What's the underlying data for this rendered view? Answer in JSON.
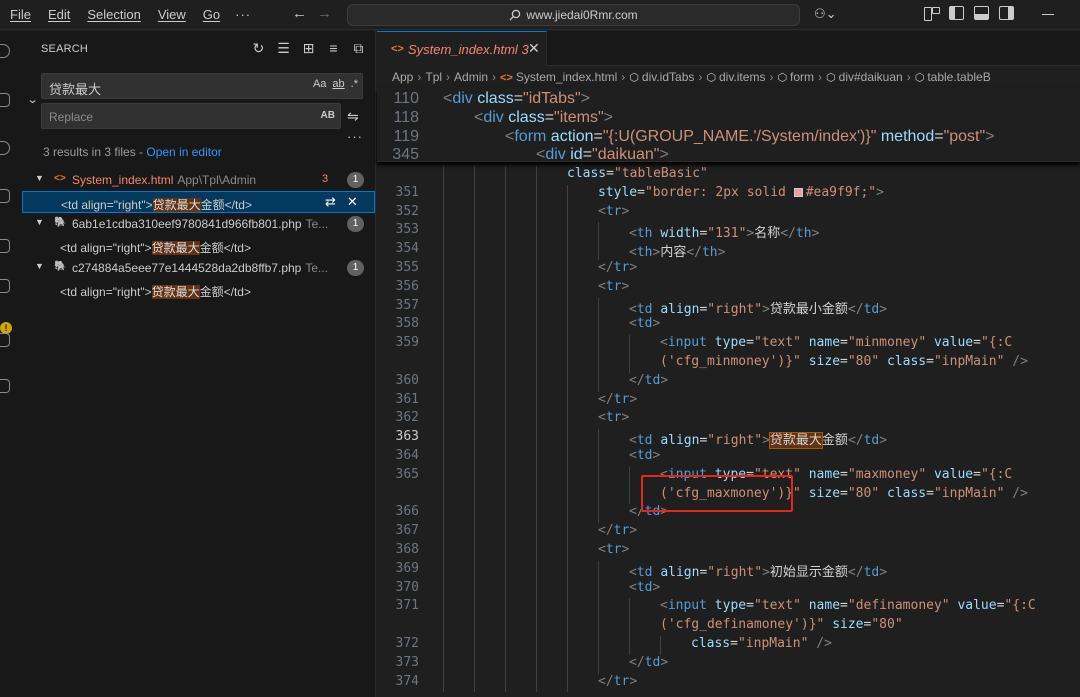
{
  "titlebar": {
    "menu": [
      "File",
      "Edit",
      "Selection",
      "View",
      "Go"
    ],
    "more": "···",
    "command_center": "www.jiedai0Rmr.com"
  },
  "sidebar": {
    "title": "SEARCH",
    "search_value": "贷款最大",
    "search_opts": [
      "Aa",
      "ab",
      ".*"
    ],
    "replace_placeholder": "Replace",
    "replace_opt": "AB",
    "summary": "3 results in 3 files - ",
    "open_in_editor": "Open in editor",
    "files": [
      {
        "name": "System_index.html",
        "path": "App\\Tpl\\Admin",
        "problems": "3",
        "count": "1",
        "match": {
          "pre": "<td align=\"right\">",
          "hit": "贷款最大",
          "post": "金额</td>"
        }
      },
      {
        "name": "6ab1e1cdba310eef9780841d966fb801.php",
        "path": "Te...",
        "count": "1",
        "match": {
          "pre": "<td align=\"right\">",
          "hit": "贷款最大",
          "post": "金额</td>"
        }
      },
      {
        "name": "c274884a5eee77e1444528da2db8ffb7.php",
        "path": "Te...",
        "count": "1",
        "match": {
          "pre": "<td align=\"right\">",
          "hit": "贷款最大",
          "post": "金额</td>"
        }
      }
    ]
  },
  "editor": {
    "tab": {
      "name": "System_index.html",
      "problems": "3"
    },
    "breadcrumbs": [
      "App",
      "Tpl",
      "Admin",
      "System_index.html",
      "div.idTabs",
      "div.items",
      "form",
      "div#daikuan",
      "table.tableB"
    ],
    "sticky": [
      {
        "ln": "110",
        "indent": 0,
        "parts": [
          [
            "t",
            "<"
          ],
          [
            "tg",
            "div"
          ],
          [
            "tx",
            " "
          ],
          [
            "at",
            "class"
          ],
          [
            "tx",
            "="
          ],
          [
            "st",
            "\"idTabs\""
          ],
          [
            "t",
            ">"
          ]
        ]
      },
      {
        "ln": "118",
        "indent": 1,
        "parts": [
          [
            "t",
            "<"
          ],
          [
            "tg",
            "div"
          ],
          [
            "tx",
            " "
          ],
          [
            "at",
            "class"
          ],
          [
            "tx",
            "="
          ],
          [
            "st",
            "\"items\""
          ],
          [
            "t",
            ">"
          ]
        ]
      },
      {
        "ln": "119",
        "indent": 2,
        "parts": [
          [
            "t",
            "<"
          ],
          [
            "tg",
            "form"
          ],
          [
            "tx",
            " "
          ],
          [
            "at",
            "action"
          ],
          [
            "tx",
            "="
          ],
          [
            "st",
            "\"{:U(GROUP_NAME.'/System/index')}\""
          ],
          [
            "tx",
            " "
          ],
          [
            "at",
            "method"
          ],
          [
            "tx",
            "="
          ],
          [
            "st",
            "\"post\""
          ],
          [
            "t",
            ">"
          ]
        ]
      },
      {
        "ln": "345",
        "indent": 3,
        "parts": [
          [
            "t",
            "<"
          ],
          [
            "tg",
            "div"
          ],
          [
            "tx",
            " "
          ],
          [
            "at",
            "id"
          ],
          [
            "tx",
            "="
          ],
          [
            "st",
            "\"daikuan\""
          ],
          [
            "t",
            ">"
          ]
        ]
      }
    ],
    "lines": [
      {
        "ln": "",
        "indent": 4,
        "parts": [
          [
            "at",
            "class"
          ],
          [
            "tx",
            "="
          ],
          [
            "st",
            "\"tableBasic\""
          ]
        ]
      },
      {
        "ln": "351",
        "indent": 5,
        "parts": [
          [
            "at",
            "style"
          ],
          [
            "tx",
            "="
          ],
          [
            "st",
            "\"border: 2px solid "
          ],
          [
            "sw",
            ""
          ],
          [
            "st",
            "#ea9f9f;\""
          ],
          [
            "t",
            ">"
          ]
        ]
      },
      {
        "ln": "352",
        "indent": 5,
        "parts": [
          [
            "t",
            "<"
          ],
          [
            "tg",
            "tr"
          ],
          [
            "t",
            ">"
          ]
        ]
      },
      {
        "ln": "353",
        "indent": 6,
        "parts": [
          [
            "t",
            "<"
          ],
          [
            "tg",
            "th"
          ],
          [
            "tx",
            " "
          ],
          [
            "at",
            "width"
          ],
          [
            "tx",
            "="
          ],
          [
            "st",
            "\"131\""
          ],
          [
            "t",
            ">"
          ],
          [
            "tx",
            "名称"
          ],
          [
            "t",
            "</"
          ],
          [
            "tg",
            "th"
          ],
          [
            "t",
            ">"
          ]
        ]
      },
      {
        "ln": "354",
        "indent": 6,
        "parts": [
          [
            "t",
            "<"
          ],
          [
            "tg",
            "th"
          ],
          [
            "t",
            ">"
          ],
          [
            "tx",
            "内容"
          ],
          [
            "t",
            "</"
          ],
          [
            "tg",
            "th"
          ],
          [
            "t",
            ">"
          ]
        ]
      },
      {
        "ln": "355",
        "indent": 5,
        "parts": [
          [
            "t",
            "</"
          ],
          [
            "tg",
            "tr"
          ],
          [
            "t",
            ">"
          ]
        ]
      },
      {
        "ln": "356",
        "indent": 5,
        "parts": [
          [
            "t",
            "<"
          ],
          [
            "tg",
            "tr"
          ],
          [
            "t",
            ">"
          ]
        ]
      },
      {
        "ln": "357",
        "indent": 6,
        "parts": [
          [
            "t",
            "<"
          ],
          [
            "tg",
            "td"
          ],
          [
            "tx",
            " "
          ],
          [
            "at",
            "align"
          ],
          [
            "tx",
            "="
          ],
          [
            "st",
            "\"right\""
          ],
          [
            "t",
            ">"
          ],
          [
            "tx",
            "贷款最小金额"
          ],
          [
            "t",
            "</"
          ],
          [
            "tg",
            "td"
          ],
          [
            "t",
            ">"
          ]
        ]
      },
      {
        "ln": "358",
        "indent": 6,
        "parts": [
          [
            "t",
            "<"
          ],
          [
            "tg",
            "td"
          ],
          [
            "t",
            ">"
          ]
        ]
      },
      {
        "ln": "359",
        "indent": 7,
        "parts": [
          [
            "t",
            "<"
          ],
          [
            "tg",
            "input"
          ],
          [
            "tx",
            " "
          ],
          [
            "at",
            "type"
          ],
          [
            "tx",
            "="
          ],
          [
            "st",
            "\"text\""
          ],
          [
            "tx",
            " "
          ],
          [
            "at",
            "name"
          ],
          [
            "tx",
            "="
          ],
          [
            "st",
            "\"minmoney\""
          ],
          [
            "tx",
            " "
          ],
          [
            "at",
            "value"
          ],
          [
            "tx",
            "="
          ],
          [
            "st",
            "\"{:C"
          ]
        ]
      },
      {
        "ln": "",
        "indent": 7,
        "parts": [
          [
            "st",
            "('cfg_minmoney')}\""
          ],
          [
            "tx",
            " "
          ],
          [
            "at",
            "size"
          ],
          [
            "tx",
            "="
          ],
          [
            "st",
            "\"80\""
          ],
          [
            "tx",
            " "
          ],
          [
            "at",
            "class"
          ],
          [
            "tx",
            "="
          ],
          [
            "st",
            "\"inpMain\""
          ],
          [
            "tx",
            " "
          ],
          [
            "t",
            "/>"
          ]
        ]
      },
      {
        "ln": "360",
        "indent": 6,
        "parts": [
          [
            "t",
            "</"
          ],
          [
            "tg",
            "td"
          ],
          [
            "t",
            ">"
          ]
        ]
      },
      {
        "ln": "361",
        "indent": 5,
        "parts": [
          [
            "t",
            "</"
          ],
          [
            "tg",
            "tr"
          ],
          [
            "t",
            ">"
          ]
        ]
      },
      {
        "ln": "362",
        "indent": 5,
        "parts": [
          [
            "t",
            "<"
          ],
          [
            "tg",
            "tr"
          ],
          [
            "t",
            ">"
          ]
        ]
      },
      {
        "ln": "363",
        "indent": 6,
        "cur": true,
        "parts": [
          [
            "t",
            "<"
          ],
          [
            "tg",
            "td"
          ],
          [
            "tx",
            " "
          ],
          [
            "at",
            "align"
          ],
          [
            "tx",
            "="
          ],
          [
            "st",
            "\"right\""
          ],
          [
            "t",
            ">"
          ],
          [
            "hl",
            "贷款最大"
          ],
          [
            "tx",
            "金额"
          ],
          [
            "t",
            "</"
          ],
          [
            "tg",
            "td"
          ],
          [
            "t",
            ">"
          ]
        ]
      },
      {
        "ln": "364",
        "indent": 6,
        "parts": [
          [
            "t",
            "<"
          ],
          [
            "tg",
            "td"
          ],
          [
            "t",
            ">"
          ]
        ]
      },
      {
        "ln": "365",
        "indent": 7,
        "parts": [
          [
            "t",
            "<"
          ],
          [
            "tg",
            "input"
          ],
          [
            "tx",
            " "
          ],
          [
            "at",
            "type"
          ],
          [
            "tx",
            "="
          ],
          [
            "st",
            "\"text\""
          ],
          [
            "tx",
            " "
          ],
          [
            "at",
            "name"
          ],
          [
            "tx",
            "="
          ],
          [
            "st",
            "\"maxmoney\""
          ],
          [
            "tx",
            " "
          ],
          [
            "at",
            "value"
          ],
          [
            "tx",
            "="
          ],
          [
            "st",
            "\"{:C"
          ]
        ]
      },
      {
        "ln": "",
        "indent": 7,
        "parts": [
          [
            "st",
            "('cfg_maxmoney')}\""
          ],
          [
            "tx",
            " "
          ],
          [
            "at",
            "size"
          ],
          [
            "tx",
            "="
          ],
          [
            "st",
            "\"80\""
          ],
          [
            "tx",
            " "
          ],
          [
            "at",
            "class"
          ],
          [
            "tx",
            "="
          ],
          [
            "st",
            "\"inpMain\""
          ],
          [
            "tx",
            " "
          ],
          [
            "t",
            "/>"
          ]
        ]
      },
      {
        "ln": "366",
        "indent": 6,
        "parts": [
          [
            "t",
            "</"
          ],
          [
            "tg",
            "td"
          ],
          [
            "t",
            ">"
          ]
        ]
      },
      {
        "ln": "367",
        "indent": 5,
        "parts": [
          [
            "t",
            "</"
          ],
          [
            "tg",
            "tr"
          ],
          [
            "t",
            ">"
          ]
        ]
      },
      {
        "ln": "368",
        "indent": 5,
        "parts": [
          [
            "t",
            "<"
          ],
          [
            "tg",
            "tr"
          ],
          [
            "t",
            ">"
          ]
        ]
      },
      {
        "ln": "369",
        "indent": 6,
        "parts": [
          [
            "t",
            "<"
          ],
          [
            "tg",
            "td"
          ],
          [
            "tx",
            " "
          ],
          [
            "at",
            "align"
          ],
          [
            "tx",
            "="
          ],
          [
            "st",
            "\"right\""
          ],
          [
            "t",
            ">"
          ],
          [
            "tx",
            "初始显示金额"
          ],
          [
            "t",
            "</"
          ],
          [
            "tg",
            "td"
          ],
          [
            "t",
            ">"
          ]
        ]
      },
      {
        "ln": "370",
        "indent": 6,
        "parts": [
          [
            "t",
            "<"
          ],
          [
            "tg",
            "td"
          ],
          [
            "t",
            ">"
          ]
        ]
      },
      {
        "ln": "371",
        "indent": 7,
        "parts": [
          [
            "t",
            "<"
          ],
          [
            "tg",
            "input"
          ],
          [
            "tx",
            " "
          ],
          [
            "at",
            "type"
          ],
          [
            "tx",
            "="
          ],
          [
            "st",
            "\"text\""
          ],
          [
            "tx",
            " "
          ],
          [
            "at",
            "name"
          ],
          [
            "tx",
            "="
          ],
          [
            "st",
            "\"definamoney\""
          ],
          [
            "tx",
            " "
          ],
          [
            "at",
            "value"
          ],
          [
            "tx",
            "="
          ],
          [
            "st",
            "\"{:C"
          ]
        ]
      },
      {
        "ln": "",
        "indent": 7,
        "parts": [
          [
            "st",
            "('cfg_definamoney')}\""
          ],
          [
            "tx",
            " "
          ],
          [
            "at",
            "size"
          ],
          [
            "tx",
            "="
          ],
          [
            "st",
            "\"80\""
          ]
        ]
      },
      {
        "ln": "372",
        "indent": 8,
        "parts": [
          [
            "at",
            "class"
          ],
          [
            "tx",
            "="
          ],
          [
            "st",
            "\"inpMain\""
          ],
          [
            "tx",
            " "
          ],
          [
            "t",
            "/>"
          ]
        ]
      },
      {
        "ln": "373",
        "indent": 6,
        "parts": [
          [
            "t",
            "</"
          ],
          [
            "tg",
            "td"
          ],
          [
            "t",
            ">"
          ]
        ]
      },
      {
        "ln": "374",
        "indent": 5,
        "parts": [
          [
            "t",
            "</"
          ],
          [
            "tg",
            "tr"
          ],
          [
            "t",
            ">"
          ]
        ]
      }
    ]
  }
}
